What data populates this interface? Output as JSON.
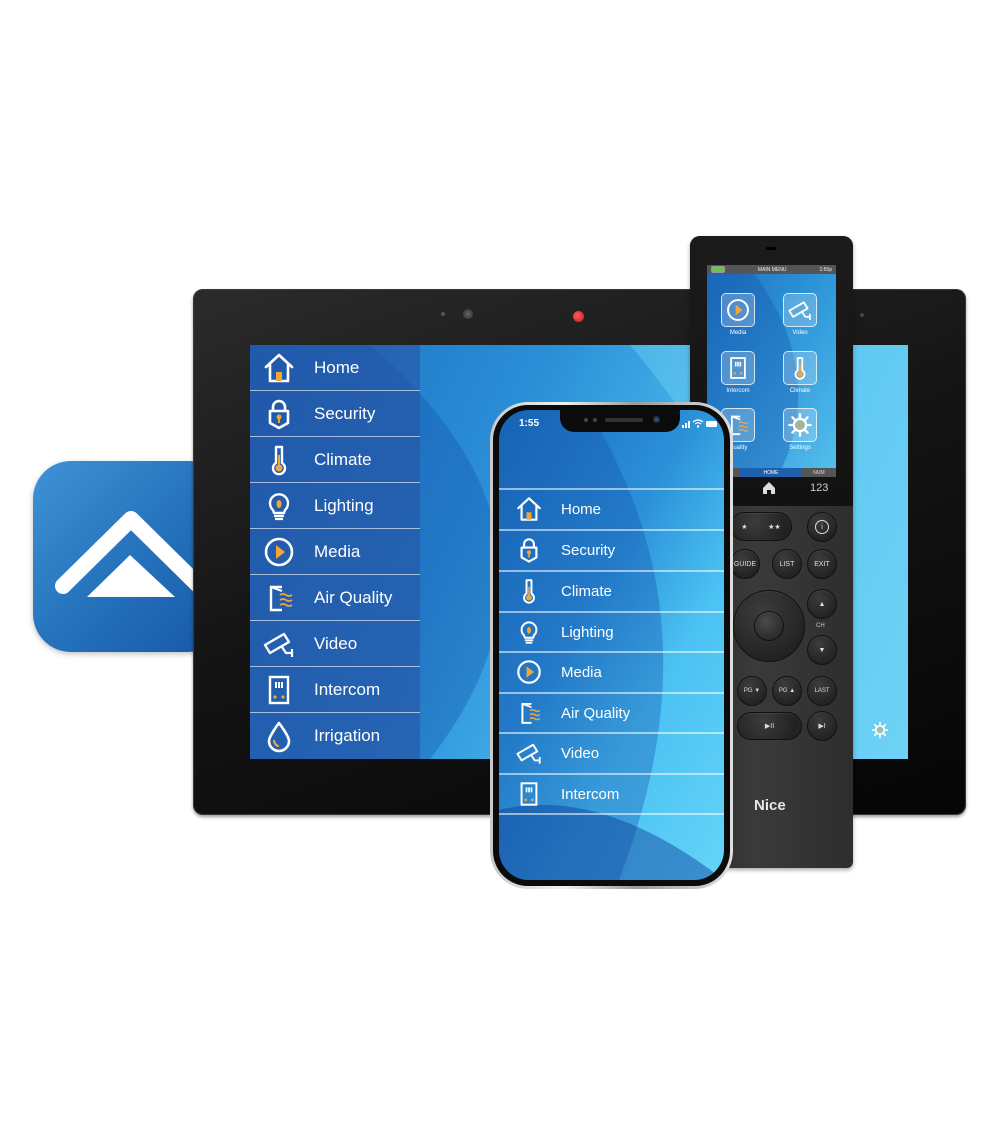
{
  "scene": {
    "description": "Smart home control app shown on wall tablet, smartphone and handheld remote",
    "colors": {
      "app_icon_blue": "#2673bd",
      "screen_blue": "#2b90d8",
      "accent_orange": "#f2a63a",
      "device_black": "#141414"
    }
  },
  "app_icon": {
    "icon": "house-roof-icon"
  },
  "tablet": {
    "menu": [
      {
        "label": "Home",
        "icon": "home-icon"
      },
      {
        "label": "Security",
        "icon": "padlock-icon"
      },
      {
        "label": "Climate",
        "icon": "thermometer-icon"
      },
      {
        "label": "Lighting",
        "icon": "lightbulb-icon"
      },
      {
        "label": "Media",
        "icon": "play-circle-icon"
      },
      {
        "label": "Air Quality",
        "icon": "air-quality-icon"
      },
      {
        "label": "Video",
        "icon": "security-camera-icon"
      },
      {
        "label": "Intercom",
        "icon": "intercom-icon"
      },
      {
        "label": "Irrigation",
        "icon": "water-drop-icon"
      }
    ],
    "settings_icon": "gear-icon"
  },
  "phone": {
    "status_time": "1:55",
    "menu": [
      {
        "label": "Home",
        "icon": "home-icon"
      },
      {
        "label": "Security",
        "icon": "padlock-icon"
      },
      {
        "label": "Climate",
        "icon": "thermometer-icon"
      },
      {
        "label": "Lighting",
        "icon": "lightbulb-icon"
      },
      {
        "label": "Media",
        "icon": "play-circle-icon"
      },
      {
        "label": "Air Quality",
        "icon": "air-quality-icon"
      },
      {
        "label": "Video",
        "icon": "security-camera-icon"
      },
      {
        "label": "Intercom",
        "icon": "intercom-icon"
      }
    ]
  },
  "remote": {
    "screen_title": "MAIN MENU",
    "screen_time": "1:55p",
    "tiles": [
      {
        "label": "Media",
        "icon": "play-circle-icon"
      },
      {
        "label": "Video",
        "icon": "security-camera-icon"
      },
      {
        "label": "Intercom",
        "icon": "intercom-icon"
      },
      {
        "label": "Climate",
        "icon": "thermometer-icon"
      },
      {
        "label": "Quality",
        "icon": "air-quality-icon"
      },
      {
        "label": "Settings",
        "icon": "gear-icon"
      }
    ],
    "tabs": [
      "",
      "HOME",
      "NUM"
    ],
    "home_key_icon": "home-icon",
    "num_key": "123",
    "buttons": {
      "fav1": "★",
      "fav2": "★★",
      "info": "i",
      "guide": "GUIDE",
      "list": "LIST",
      "exit": "EXIT",
      "ch_up": "▲",
      "ch_label": "CH",
      "ch_down": "▼",
      "pg_down": "PG ▼",
      "pg_up": "PG ▲",
      "last": "LAST",
      "play_pause": "▶II",
      "skip": "▶I"
    },
    "brand": "Nice"
  }
}
